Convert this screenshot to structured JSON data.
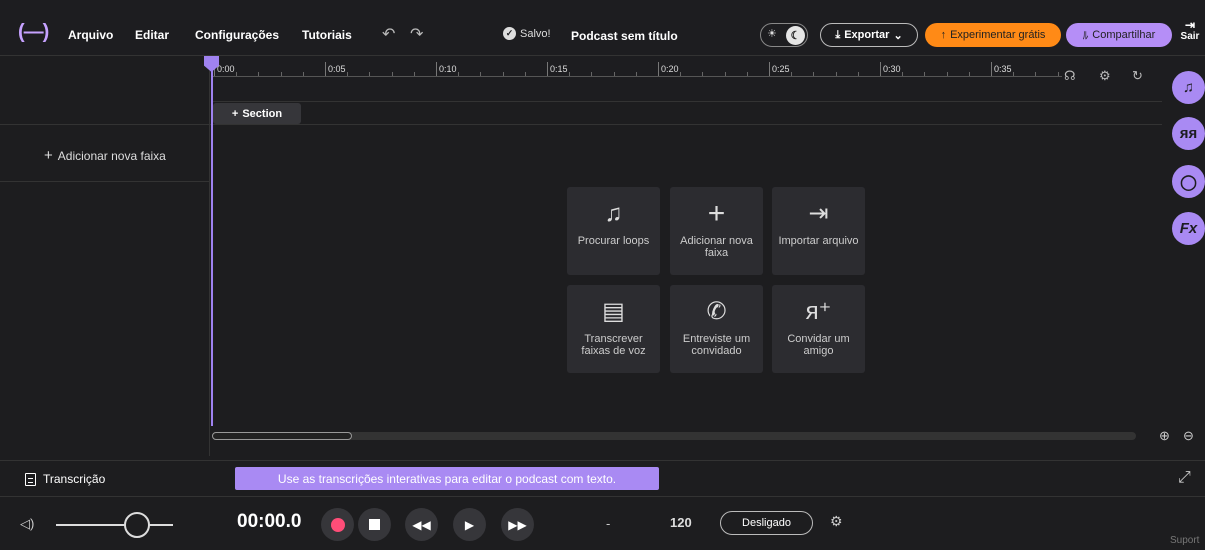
{
  "header": {
    "logo": "(—)",
    "menu": [
      "Arquivo",
      "Editar",
      "Configurações",
      "Tutoriais"
    ],
    "saved_label": "Salvo!",
    "project_title": "Podcast sem título",
    "export_label": "Exportar",
    "try_label": "Experimentar grátis",
    "share_label": "Compartilhar",
    "exit_label": "Sair"
  },
  "timeline": {
    "ticks": [
      "0:00",
      "0:05",
      "0:10",
      "0:15",
      "0:20",
      "0:25",
      "0:30",
      "0:35"
    ],
    "section_label": "Section",
    "add_track_label": "Adicionar nova faixa"
  },
  "tiles": [
    {
      "icon": "music-note-icon",
      "label": "Procurar loops"
    },
    {
      "icon": "plus-icon",
      "label": "Adicionar nova faixa"
    },
    {
      "icon": "import-icon",
      "label": "Importar arquivo"
    },
    {
      "icon": "document-icon",
      "label": "Transcrever faixas de voz"
    },
    {
      "icon": "phone-icon",
      "label": "Entreviste um convidado"
    },
    {
      "icon": "invite-user-icon",
      "label": "Convidar um amigo"
    }
  ],
  "side_buttons": [
    "music-icon",
    "collaborators-icon",
    "comments-icon",
    "effects-icon"
  ],
  "side_effects_label": "Fx",
  "transcription": {
    "label": "Transcrição",
    "banner": "Use as transcrições interativas para editar o podcast com texto."
  },
  "transport": {
    "timecode": "00:00.0",
    "tempo_placeholder": "-",
    "bpm": "120",
    "metronome": "Desligado",
    "support": "Suport"
  },
  "colors": {
    "accent": "#a98af3",
    "orange": "#ff8a16",
    "record": "#ff4d78",
    "background": "#1d1d1f"
  }
}
